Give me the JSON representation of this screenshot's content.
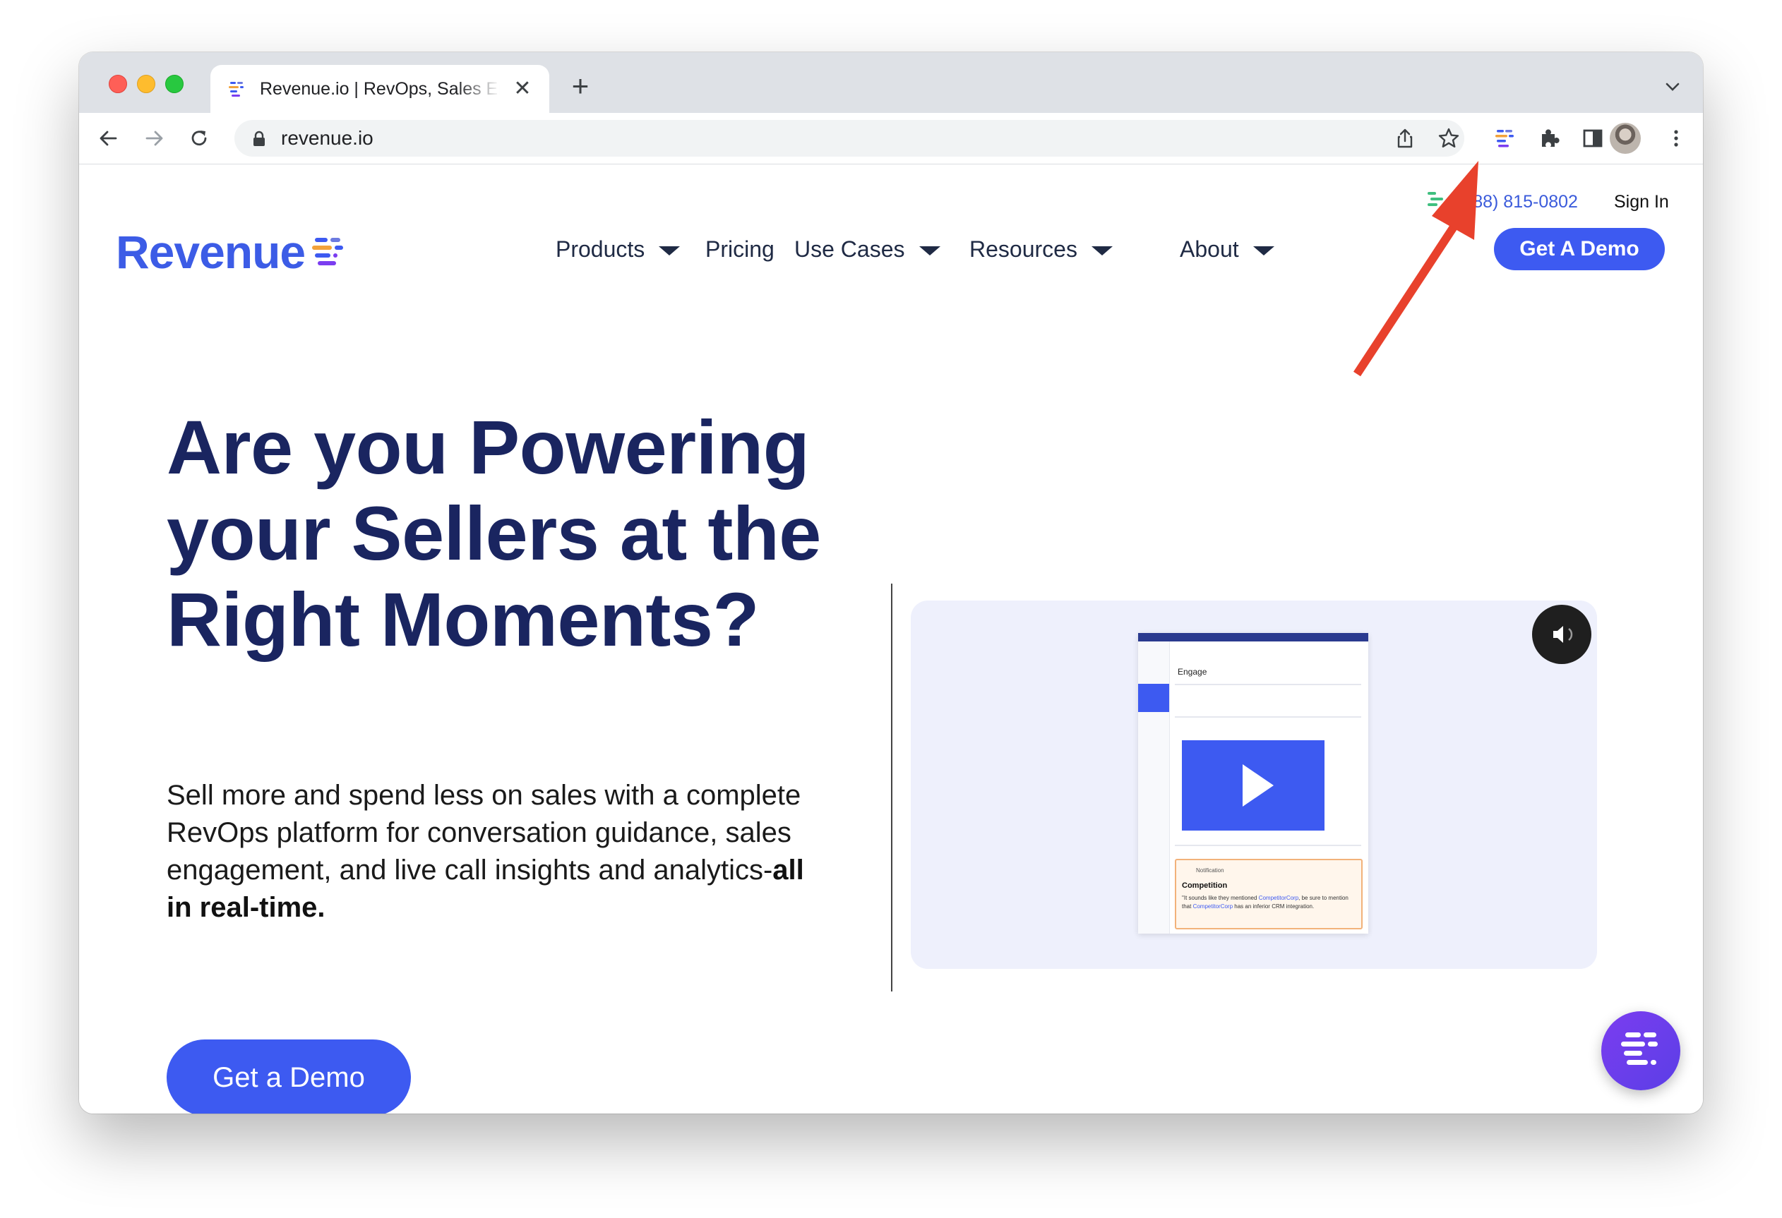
{
  "browser": {
    "tab_title": "Revenue.io | RevOps, Sales Engagement & Conversation Intelligence",
    "tab_close": "✕",
    "new_tab": "+",
    "url": "revenue.io"
  },
  "site": {
    "phone": "(888) 815-0802",
    "sign_in": "Sign In",
    "logo_text": "Revenue",
    "nav": {
      "products": "Products",
      "pricing": "Pricing",
      "use_cases": "Use Cases",
      "resources": "Resources",
      "about": "About"
    },
    "cta_top": "Get A Demo"
  },
  "hero": {
    "title": "Are you Powering your Sellers at the Right Moments?",
    "subtitle": "Sell more and spend less on sales with a complete RevOps platform for conversation guidance, sales engagement, and live call insights and analytics-",
    "subtitle_bold": "all in real-time.",
    "cta": "Get a Demo"
  },
  "video": {
    "mock_title": "Engage",
    "notif_label": "Notification",
    "notif_title": "Competition",
    "notif_text_1": "\"It sounds like they mentioned ",
    "notif_link_1": "CompetitorCorp",
    "notif_text_2": ", be sure to mention that ",
    "notif_link_2": "CompetitorCorp",
    "notif_text_3": " has an inferior CRM integration."
  },
  "colors": {
    "brand_blue": "#3d5af1",
    "navy": "#1a2560",
    "annotation_arrow": "#e8412c"
  },
  "icons": [
    "back-icon",
    "forward-icon",
    "reload-icon",
    "lock-icon",
    "share-icon",
    "star-icon",
    "revenue-extension-icon",
    "puzzle-icon",
    "side-panel-icon",
    "menu-dots-icon",
    "mute-icon",
    "play-icon",
    "chat-icon"
  ]
}
